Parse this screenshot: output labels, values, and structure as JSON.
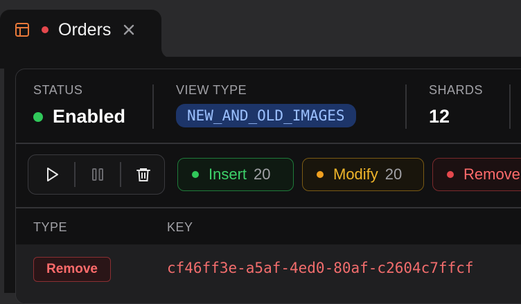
{
  "tab": {
    "title": "Orders",
    "icon": "table-icon",
    "status_color": "#e5484d"
  },
  "stats": {
    "status_label": "STATUS",
    "status_value": "Enabled",
    "view_type_label": "VIEW TYPE",
    "view_type_value": "NEW_AND_OLD_IMAGES",
    "shards_label": "SHARDS",
    "shards_value": "12"
  },
  "controls": [
    "play-icon",
    "pause-icon",
    "trash-icon"
  ],
  "filters": {
    "insert": {
      "label": "Insert",
      "count": "20",
      "color": "#30c85a"
    },
    "modify": {
      "label": "Modify",
      "count": "20",
      "color": "#f0a020"
    },
    "remove": {
      "label": "Remove",
      "color": "#e5484d"
    }
  },
  "table": {
    "columns": [
      "TYPE",
      "KEY"
    ],
    "rows": [
      {
        "type": "Remove",
        "key": "cf46ff3e-a5af-4ed0-80af-c2604c7ffcf"
      }
    ]
  },
  "colors": {
    "accent_blue": "#1d3569",
    "remove": "#ff6b6b"
  }
}
